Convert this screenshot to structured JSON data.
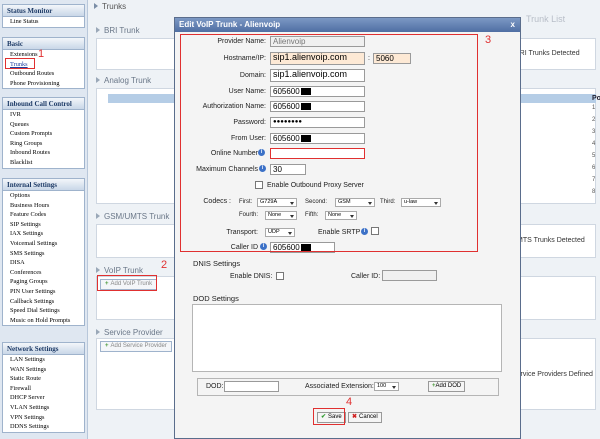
{
  "sidebar": {
    "status_monitor": {
      "title": "Status Monitor",
      "items": [
        "Line Status"
      ]
    },
    "basic": {
      "title": "Basic",
      "items": [
        "Extensions",
        "Trunks",
        "Outbound Routes",
        "Phone Provisioning"
      ]
    },
    "inbound": {
      "title": "Inbound Call Control",
      "items": [
        "IVR",
        "Queues",
        "Custom Prompts",
        "Ring Groups",
        "Inbound Routes",
        "Blacklist"
      ]
    },
    "internal": {
      "title": "Internal Settings",
      "items": [
        "Options",
        "Business Hours",
        "Feature Codes",
        "SIP Settings",
        "IAX Settings",
        "Voicemail Settings",
        "SMS Settings",
        "DISA",
        "Conferences",
        "Paging Groups",
        "PIN User Settings",
        "Callback Settings",
        "Speed Dial Settings",
        "Music on Hold Prompts"
      ]
    },
    "network": {
      "title": "Network Settings",
      "items": [
        "LAN Settings",
        "WAN Settings",
        "Static Route",
        "Firewall",
        "DHCP Server",
        "VLAN Settings",
        "VPN Settings",
        "DDNS Settings"
      ]
    }
  },
  "main": {
    "breadcrumb": "Trunks",
    "trunk_list": "Trunk List",
    "bri_title": "BRI Trunk",
    "bri_detected": "BRI Trunks Detected",
    "analog_title": "Analog Trunk",
    "analog_col": "Po",
    "analog_rows": [
      "1",
      "2",
      "3",
      "4",
      "5",
      "6",
      "7",
      "8"
    ],
    "gsm_title": "GSM/UMTS Trunk",
    "gsm_detected": "UMTS Trunks Detected",
    "voip_title": "VoIP Trunk",
    "add_voip": "Add VoIP Trunk",
    "sp_title": "Service Provider",
    "add_sp": "Add Service Provider",
    "sp_detected": "Service Providers Defined"
  },
  "annotations": [
    "1",
    "2",
    "3",
    "4"
  ],
  "dialog": {
    "title": "Edit VoIP Trunk - Alienvoip",
    "close": "x",
    "provider_label": "Provider Name:",
    "provider_value": "Alienvoip",
    "hostname_label": "Hostname/IP:",
    "hostname_value": "sip1.alienvoip.com",
    "port_sep": ":",
    "port_value": "5060",
    "domain_label": "Domain:",
    "domain_value": "sip1.alienvoip.com",
    "username_label": "User Name:",
    "username_value": "605600",
    "authname_label": "Authorization Name:",
    "authname_value": "605600",
    "password_label": "Password:",
    "password_value": "●●●●●●●●",
    "fromuser_label": "From User:",
    "fromuser_value": "605600",
    "online_label": "Online Number",
    "online_value": "",
    "maxch_label": "Maximum Channels",
    "maxch_value": "30",
    "outbound_proxy_label": "Enable Outbound Proxy Server",
    "codecs_label": "Codecs :",
    "first_label": "First:",
    "first_value": "G729A",
    "second_label": "Second:",
    "second_value": "GSM",
    "third_label": "Third:",
    "third_value": "u-law",
    "fourth_label": "Fourth:",
    "fourth_value": "None",
    "fifth_label": "Fifth:",
    "fifth_value": "None",
    "transport_label": "Transport:",
    "transport_value": "UDP",
    "srtp_label": "Enable SRTP",
    "callerid_label": "Caller ID",
    "callerid_value": "605600",
    "dnis_title": "DNIS Settings",
    "enable_dnis_label": "Enable DNIS:",
    "dnis_callerid_label": "Caller ID:",
    "dod_title": "DOD Settings",
    "dod_label": "DOD:",
    "assoc_label": "Associated Extension:",
    "assoc_value": "100",
    "add_dod": "Add DOD",
    "save": "Save",
    "cancel": "Cancel"
  },
  "colors": {
    "annotation": "#e03030",
    "title_bar": "#5a78ad",
    "highlight_input": "#fde9d5"
  }
}
